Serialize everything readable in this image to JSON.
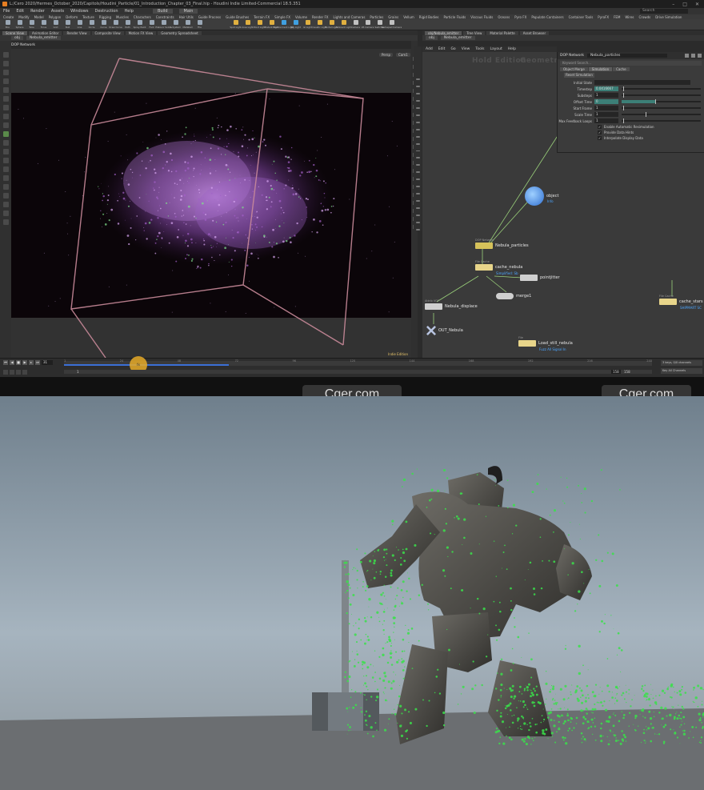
{
  "window": {
    "title": "L:/Cero 2020/Hermes_October_2020/Capitols/Houdini_Particle/01_Introduction_Chapter_03_Final.hip - Houdini Indie Limited-Commercial 18.5.351",
    "controls": [
      "–",
      "□",
      "✕"
    ]
  },
  "menu": {
    "items": [
      "File",
      "Edit",
      "Render",
      "Assets",
      "Windows",
      "Destruction",
      "Help"
    ],
    "desktop": "Build",
    "context": "Main",
    "search": "Search"
  },
  "shelf_tabs": [
    "Create",
    "Modify",
    "Model",
    "Polygon",
    "Deform",
    "Texture",
    "Rigging",
    "Muscles",
    "Characters",
    "Constraints",
    "Hair Utils",
    "Guide Process",
    "Guide Brushes",
    "Terrain FX",
    "Simple FX",
    "Volume",
    "Render FX",
    "Lights and Cameras",
    "Particles",
    "Grains",
    "Vellum",
    "Rigid Bodies",
    "Particle Fluids",
    "Viscous Fluids",
    "Oceans",
    "Pyro FX",
    "Populate Containers",
    "Container Tools",
    "PyroFX",
    "FEM",
    "Wires",
    "Crowds",
    "Drive Simulation"
  ],
  "shelf_tools": [
    {
      "label": "Box",
      "color": "#9aa7b5"
    },
    {
      "label": "Sphere",
      "color": "#9aa7b5"
    },
    {
      "label": "Tube",
      "color": "#9aa7b5"
    },
    {
      "label": "Torus",
      "color": "#9aa7b5"
    },
    {
      "label": "Grid",
      "color": "#9aa7b5"
    },
    {
      "label": "Null",
      "color": "#9aa7b5"
    },
    {
      "label": "Line",
      "color": "#9aa7b5"
    },
    {
      "label": "Circle",
      "color": "#9aa7b5"
    },
    {
      "label": "Curve",
      "color": "#9aa7b5"
    },
    {
      "label": "Draw Curve",
      "color": "#9aa7b5"
    },
    {
      "label": "Path",
      "color": "#9aa7b5"
    },
    {
      "label": "Spray Paint",
      "color": "#9aa7b5"
    },
    {
      "label": "Font",
      "color": "#9aa7b5"
    },
    {
      "label": "Platonic Solids",
      "color": "#9aa7b5"
    },
    {
      "label": "L-System",
      "color": "#9aa7b5"
    },
    {
      "label": "Metaball",
      "color": "#9aa7b5"
    },
    {
      "label": "File",
      "color": "#9aa7b5"
    },
    {
      "label": "Spot Light",
      "color": "#e0b040"
    },
    {
      "label": "Area Light",
      "color": "#e0b040"
    },
    {
      "label": "Point Light",
      "color": "#e0b040"
    },
    {
      "label": "Distant Light",
      "color": "#e0b040"
    },
    {
      "label": "Environment Light",
      "color": "#40a0e0"
    },
    {
      "label": "Sky Light",
      "color": "#40a0e0"
    },
    {
      "label": "GI Light",
      "color": "#e0b040"
    },
    {
      "label": "Caustic Light",
      "color": "#e0b040"
    },
    {
      "label": "Portal Light",
      "color": "#e0b040"
    },
    {
      "label": "Ambient Light",
      "color": "#e0b040"
    },
    {
      "label": "Camera",
      "color": "#c0c0c0"
    },
    {
      "label": "VR Camera",
      "color": "#c0c0c0"
    },
    {
      "label": "Switcher",
      "color": "#c0c0c0"
    },
    {
      "label": "Gamepad Camera",
      "color": "#c0c0c0"
    }
  ],
  "desk_tabs": [
    "Scene View",
    "Animation Editor",
    "Render View",
    "Composite View",
    "Motion FX View",
    "Geometry Spreadsheet"
  ],
  "viewport": {
    "path": "obj",
    "node_path": "Nebula_emitter",
    "header": "DOP Network",
    "persp": "Persp",
    "cam": "Cam1",
    "indie_label": "Indie Edition"
  },
  "network": {
    "tabs": [
      "obj/Nebula_emitter",
      "Tree View",
      "Material Palette",
      "Asset Browser"
    ],
    "path": [
      "obj",
      "Nebula_emitter"
    ],
    "menu": [
      "Add",
      "Edit",
      "Go",
      "View",
      "Tools",
      "Layout",
      "Help"
    ],
    "watermarks": [
      "Geometry",
      "Hold Edition"
    ],
    "nodes": [
      {
        "name": "Nebula_particles",
        "type": "DOP Network",
        "sub": "",
        "color": "#d6c25a"
      },
      {
        "name": "cache_nebula",
        "type": "File Cache",
        "sub": "Simplified: Sb",
        "color": "#e8d58a"
      },
      {
        "name": "pointjitter",
        "type": "",
        "sub": "",
        "color": "#cfcfcf"
      },
      {
        "name": "merge1",
        "type": "",
        "sub": "",
        "color": "#cfcfcf"
      },
      {
        "name": "Nebula_displace",
        "type": "Attrib VOP",
        "sub": "",
        "color": "#cfcfcf"
      },
      {
        "name": "OUT_Nebula",
        "type": "",
        "sub": "",
        "color": "#b8c4e0"
      },
      {
        "name": "Load_still_nebula",
        "type": "File",
        "sub": "Fuzz All Signal In",
        "color": "#e8d58a"
      },
      {
        "name": "cache_stars",
        "type": "File Cache",
        "sub": "SHIPMART SC",
        "color": "#e8d58a"
      },
      {
        "name": "object",
        "type": "",
        "sub": "Info",
        "color": "#4a8fe0"
      }
    ]
  },
  "params": {
    "type": "DOP Network",
    "name": "Nebula_particles",
    "keyword_placeholder": "Keyword Search...",
    "tabs": [
      "Object Merge",
      "Simulation",
      "Cache"
    ],
    "reset_label": "Reset Simulation",
    "initial_state_label": "Initial State",
    "rows": [
      {
        "label": "Timestep",
        "value": "0.0416667"
      },
      {
        "label": "Substeps",
        "value": "1"
      },
      {
        "label": "Offset Time",
        "value": "0"
      },
      {
        "label": "Start Frame",
        "value": "1"
      },
      {
        "label": "Scale Time",
        "value": "1"
      },
      {
        "label": "Max Feedback Loops",
        "value": "1"
      }
    ],
    "checks": [
      "Enable Automatic Resimulation",
      "Provide Data Hints",
      "Interpolate Display Data"
    ],
    "offset_fill": 0.42
  },
  "timeline": {
    "frame": "31",
    "ticks": [
      "1",
      "24",
      "48",
      "72",
      "96",
      "120",
      "144",
      "168",
      "192",
      "216",
      "240"
    ],
    "cache_fraction": 0.28,
    "marker_label": "fx",
    "start": "1",
    "end": "158",
    "end2": "158",
    "right": [
      "3 keys, 0/0 channels",
      "Key All Channels"
    ]
  },
  "watermarks": [
    "Cger.com",
    "Cger.com"
  ],
  "colors": {
    "accent": "#3c7f77",
    "nebula_particles": "#a35fc7",
    "render_particles": "#39e04a",
    "bbox": "#c98a9a"
  }
}
